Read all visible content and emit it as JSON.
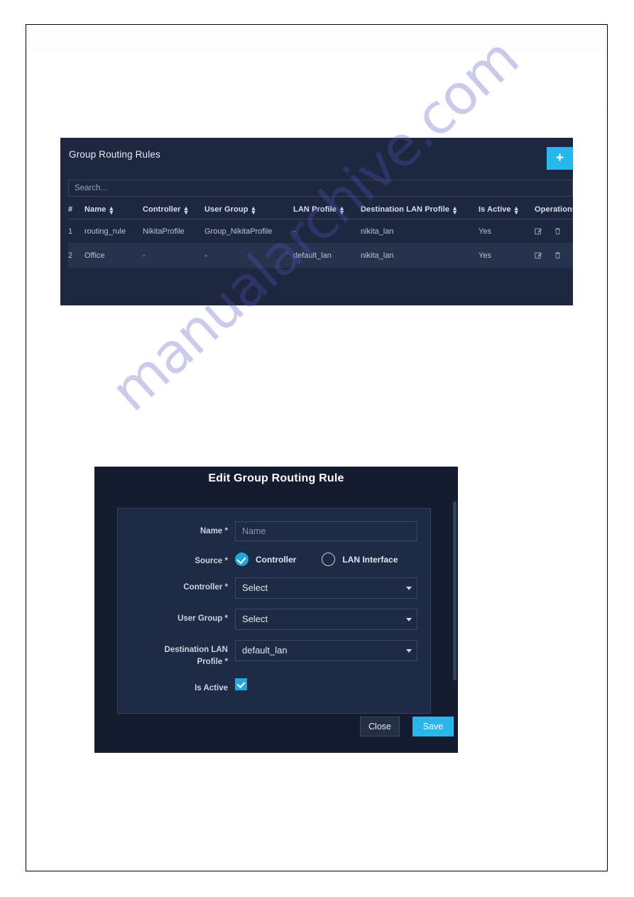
{
  "watermark": {
    "text": "manualarchive.com",
    "color": "#5652be"
  },
  "panel": {
    "title": "Group Routing Rules",
    "add_button_label": "+",
    "search": {
      "placeholder": "Search...",
      "value": ""
    },
    "table": {
      "columns": [
        {
          "label": "#",
          "sortable": false
        },
        {
          "label": "Name",
          "sortable": true
        },
        {
          "label": "Controller",
          "sortable": true
        },
        {
          "label": "User Group",
          "sortable": true
        },
        {
          "label": "LAN Profile",
          "sortable": true
        },
        {
          "label": "Destination LAN Profile",
          "sortable": true
        },
        {
          "label": "Is Active",
          "sortable": true
        },
        {
          "label": "Operations",
          "sortable": false
        }
      ],
      "rows": [
        {
          "num": "1",
          "name": "routing_rule",
          "controller": "NikitaProfile",
          "user_group": "Group_NikitaProfile",
          "lan_profile": "-",
          "dest_lan_profile": "nikita_lan",
          "is_active": "Yes"
        },
        {
          "num": "2",
          "name": "Office",
          "controller": "-",
          "user_group": "-",
          "lan_profile": "default_lan",
          "dest_lan_profile": "nikita_lan",
          "is_active": "Yes"
        }
      ],
      "operations": {
        "edit_icon": "edit-icon",
        "delete_icon": "trash-icon"
      }
    }
  },
  "modal": {
    "title": "Edit Group Routing Rule",
    "fields": {
      "name": {
        "label": "Name *",
        "placeholder": "Name",
        "value": ""
      },
      "source": {
        "label": "Source *",
        "options": [
          {
            "label": "Controller",
            "selected": true
          },
          {
            "label": "LAN Interface",
            "selected": false
          }
        ]
      },
      "controller": {
        "label": "Controller *",
        "value": "Select"
      },
      "user_group": {
        "label": "User Group *",
        "value": "Select"
      },
      "dest_lan_profile": {
        "label_line1": "Destination LAN",
        "label_line2": "Profile *",
        "value": "default_lan"
      },
      "is_active": {
        "label": "Is Active",
        "checked": true
      }
    },
    "footer": {
      "close_label": "Close",
      "save_label": "Save"
    }
  },
  "colors": {
    "accent": "#29b6e8",
    "panel_bg": "#1d2740",
    "modal_bg": "#141d30",
    "modal_body_bg": "#1f2a44",
    "row_alt_bg": "#27334d"
  }
}
